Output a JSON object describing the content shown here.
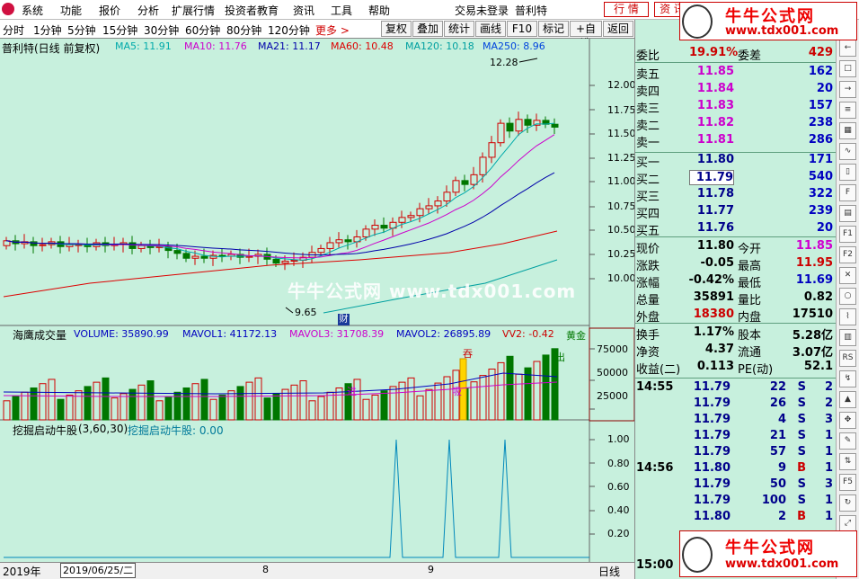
{
  "menubar": {
    "items": [
      "系统",
      "功能",
      "报价",
      "分析",
      "扩展行情",
      "投资者教育",
      "资讯",
      "工具",
      "帮助"
    ],
    "status": "交易未登录",
    "stock_name": "普利特",
    "tab_quote": "行 情",
    "tab_info": "资 讯"
  },
  "toolbar": {
    "periods": [
      "分时",
      "1分钟",
      "5分钟",
      "15分钟",
      "30分钟",
      "60分钟",
      "80分钟",
      "120分钟"
    ],
    "more": "更多 >",
    "buttons": [
      "复权",
      "叠加",
      "统计",
      "画线",
      "F10",
      "标记",
      "+自选",
      "返回"
    ]
  },
  "main_chart": {
    "title": "普利特(日线 前复权)",
    "ma": [
      {
        "label": "MA5: 11.91",
        "color": "#00aaaa"
      },
      {
        "label": "MA10: 11.76",
        "color": "#cc00cc"
      },
      {
        "label": "MA21: 11.17",
        "color": "#0000aa"
      },
      {
        "label": "MA60: 10.48",
        "color": "#dd0000"
      },
      {
        "label": "MA120: 10.18",
        "color": "#00a0a0"
      },
      {
        "label": "MA250: 8.96",
        "color": "#0044dd"
      }
    ],
    "high_label": "12.28",
    "low_label": "9.65",
    "price_ticks": [
      "12.00",
      "11.75",
      "11.50",
      "11.25",
      "11.00",
      "10.75",
      "10.50",
      "10.25",
      "10.00"
    ],
    "fin_badge": "财"
  },
  "volume_chart": {
    "title": "海鹰成交量",
    "volume": "VOLUME: 35890.99",
    "mavol1": "MAVOL1: 41172.13",
    "mavol3": "MAVOL3: 31708.39",
    "mavol2": "MAVOL2: 26895.89",
    "vv2": "VV2: -0.42",
    "gold": "黄金",
    "ticks": [
      "75000",
      "50000",
      "25000"
    ],
    "marks": [
      "吞",
      "进",
      "吸",
      "出"
    ]
  },
  "indicator_chart": {
    "title": "挖掘启动牛股",
    "params": "(3,60,30)",
    "value_label": "挖掘启动牛股: 0.00",
    "ticks": [
      "1.00",
      "0.80",
      "0.60",
      "0.40",
      "0.20"
    ]
  },
  "bottom_bar": {
    "year": "2019年",
    "date": "2019/06/25/二",
    "month8": "8",
    "month9": "9",
    "period": "日线"
  },
  "quote": {
    "wei_bi_label": "委比",
    "wei_bi": "19.91%",
    "wei_cha_label": "委差",
    "wei_cha": "429",
    "asks": [
      {
        "label": "卖五",
        "price": "11.85",
        "vol": "162"
      },
      {
        "label": "卖四",
        "price": "11.84",
        "vol": "20"
      },
      {
        "label": "卖三",
        "price": "11.83",
        "vol": "157"
      },
      {
        "label": "卖二",
        "price": "11.82",
        "vol": "238"
      },
      {
        "label": "卖一",
        "price": "11.81",
        "vol": "286"
      }
    ],
    "bids": [
      {
        "label": "买一",
        "price": "11.80",
        "vol": "171"
      },
      {
        "label": "买二",
        "price": "11.79",
        "vol": "540"
      },
      {
        "label": "买三",
        "price": "11.78",
        "vol": "322"
      },
      {
        "label": "买四",
        "price": "11.77",
        "vol": "239"
      },
      {
        "label": "买五",
        "price": "11.76",
        "vol": "20"
      }
    ],
    "stats": [
      {
        "l1": "现价",
        "v1": "11.80",
        "c1": "#000",
        "l2": "今开",
        "v2": "11.85",
        "c2": "#d000d0"
      },
      {
        "l1": "涨跌",
        "v1": "-0.05",
        "c1": "#000",
        "l2": "最高",
        "v2": "11.95",
        "c2": "#cc0000"
      },
      {
        "l1": "涨幅",
        "v1": "-0.42%",
        "c1": "#000",
        "l2": "最低",
        "v2": "11.69",
        "c2": "#0000c0"
      },
      {
        "l1": "总量",
        "v1": "35891",
        "c1": "#000",
        "l2": "量比",
        "v2": "0.82",
        "c2": "#000"
      },
      {
        "l1": "外盘",
        "v1": "18380",
        "c1": "#cc0000",
        "l2": "内盘",
        "v2": "17510",
        "c2": "#000"
      }
    ],
    "stats2": [
      {
        "l1": "换手",
        "v1": "1.17%",
        "l2": "股本",
        "v2": "5.28亿"
      },
      {
        "l1": "净资",
        "v1": "4.37",
        "l2": "流通",
        "v2": "3.07亿"
      },
      {
        "l1": "收益(二)",
        "v1": "0.113",
        "l2": "PE(动)",
        "v2": "52.1"
      }
    ],
    "ticks": [
      {
        "time": "14:55",
        "price": "11.79",
        "vol": "22",
        "bs": "S",
        "n": "2"
      },
      {
        "time": "",
        "price": "11.79",
        "vol": "26",
        "bs": "S",
        "n": "2"
      },
      {
        "time": "",
        "price": "11.79",
        "vol": "4",
        "bs": "S",
        "n": "3"
      },
      {
        "time": "",
        "price": "11.79",
        "vol": "21",
        "bs": "S",
        "n": "1"
      },
      {
        "time": "",
        "price": "11.79",
        "vol": "57",
        "bs": "S",
        "n": "1"
      },
      {
        "time": "14:56",
        "price": "11.80",
        "vol": "9",
        "bs": "B",
        "n": "1"
      },
      {
        "time": "",
        "price": "11.79",
        "vol": "50",
        "bs": "S",
        "n": "3"
      },
      {
        "time": "",
        "price": "11.79",
        "vol": "100",
        "bs": "S",
        "n": "1"
      },
      {
        "time": "",
        "price": "11.80",
        "vol": "2",
        "bs": "B",
        "n": "1"
      }
    ],
    "last_time": "15:00"
  },
  "watermark": {
    "title": "牛牛公式网",
    "url": "www.tdx001.com",
    "center_text": "牛牛公式网 www.tdx001.com"
  }
}
